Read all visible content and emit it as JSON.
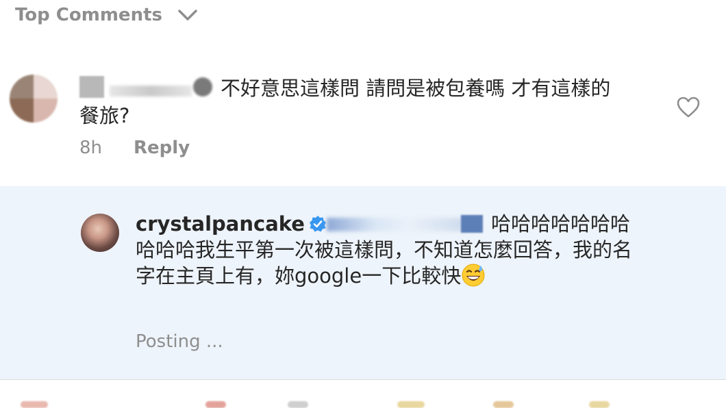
{
  "header": {
    "title": "Top Comments",
    "toggle_icon": "chevron-down-icon"
  },
  "comment": {
    "text": "不好意思這樣問 請問是被包養嗎 才有這樣的餐旅?",
    "time": "8h",
    "reply_label": "Reply",
    "like_icon": "heart-outline-icon"
  },
  "reply": {
    "username": "crystalpancake",
    "verified_icon": "verified-badge-icon",
    "text": "哈哈哈哈哈哈哈哈哈哈我生平第一次被這樣問，不知道怎麼回答，我的名字在主頁上有，妳google一下比較快",
    "emoji": "grinning-sweat-emoji",
    "status": "Posting ..."
  },
  "colors": {
    "muted": "#8e8e8e",
    "text": "#262626",
    "highlight_bg": "#eef4fb",
    "verified": "#3897f0"
  }
}
